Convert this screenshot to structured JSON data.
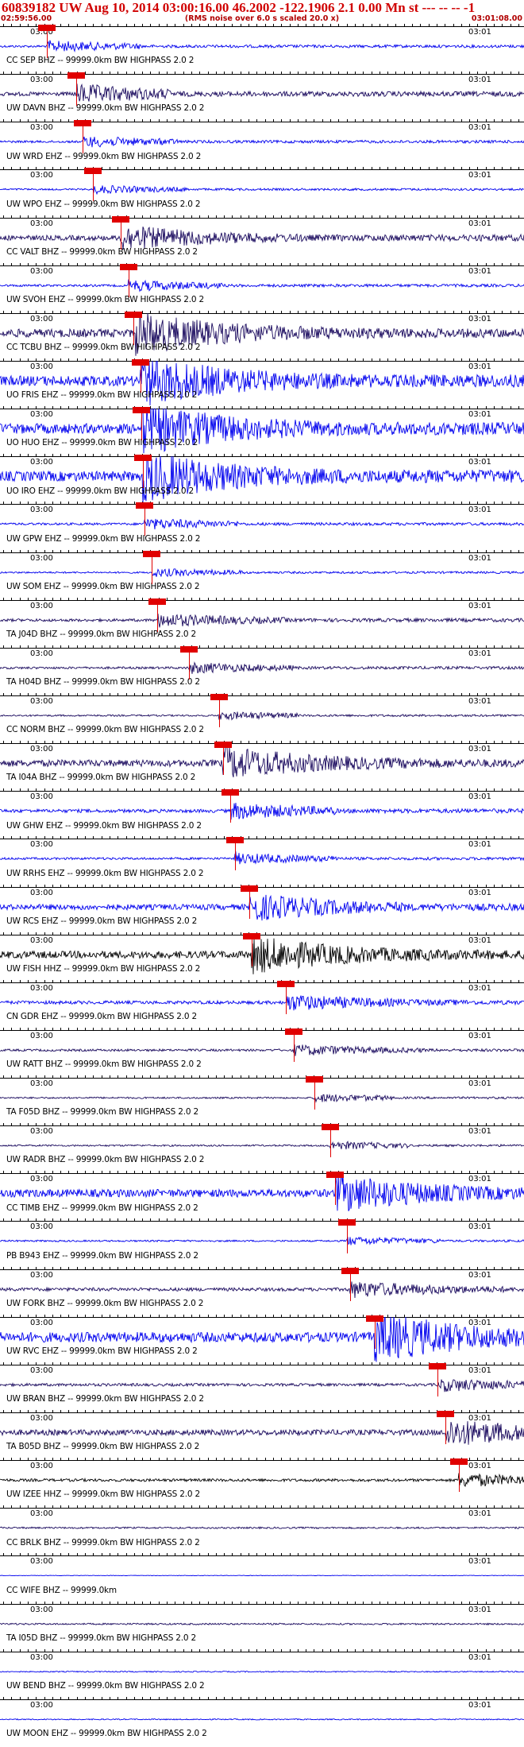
{
  "header": {
    "title": "60839182 UW Aug 10, 2014 03:00:16.00   46.2002 -122.1906  2.1 0.00 Mn st --- -- --   -1",
    "start_time": "02:59:56.00",
    "note": "(RMS noise over 6.0 s scaled 20.0 x)",
    "end_time": "03:01:08.00"
  },
  "time_labels": {
    "left": "03:00",
    "right": "03:01"
  },
  "colors": {
    "blue": "#0000ee",
    "dark": "#1a0a5e",
    "black": "#000000",
    "pick": "#e00000",
    "title": "#d00000"
  },
  "stations": [
    {
      "label": "CC SEP  BHZ -- 99999.0km BW  HIGHPASS  2.0  2",
      "color": "blue",
      "pick": 0.09,
      "burst": 0.18,
      "amp": 4
    },
    {
      "label": "UW DAVN BHZ -- 99999.0km BW  HIGHPASS  2.0  2",
      "color": "dark",
      "pick": 0.145,
      "burst": 0.18,
      "amp": 7
    },
    {
      "label": "UW WRD  EHZ -- 99999.0km BW  HIGHPASS  2.0  2",
      "color": "blue",
      "pick": 0.158,
      "burst": 0.18,
      "amp": 4
    },
    {
      "label": "UW WPO  EHZ -- 99999.0km BW  HIGHPASS  2.0  2",
      "color": "blue",
      "pick": 0.178,
      "burst": 0.18,
      "amp": 3
    },
    {
      "label": "CC VALT BHZ -- 99999.0km BW  HIGHPASS  2.0  2",
      "color": "dark",
      "pick": 0.23,
      "burst": 0.35,
      "amp": 9
    },
    {
      "label": "UW SVOH EHZ -- 99999.0km BW  HIGHPASS  2.0  2",
      "color": "blue",
      "pick": 0.245,
      "burst": 0.18,
      "amp": 4
    },
    {
      "label": "CC TCBU BHZ -- 99999.0km BW  HIGHPASS  2.0  2",
      "color": "dark",
      "pick": 0.255,
      "burst": 0.85,
      "amp": 15
    },
    {
      "label": "UO FRIS EHZ -- 99999.0km BW  HIGHPASS  2.0  2",
      "color": "blue",
      "pick": 0.268,
      "burst": 0.45,
      "amp": 18
    },
    {
      "label": "UO HUO  EHZ -- 99999.0km BW  HIGHPASS  2.0  2",
      "color": "blue",
      "pick": 0.27,
      "burst": 0.4,
      "amp": 18
    },
    {
      "label": "UO IRO  EHZ -- 99999.0km BW  HIGHPASS  2.0  2",
      "color": "blue",
      "pick": 0.272,
      "burst": 0.45,
      "amp": 18
    },
    {
      "label": "UW GPW  EHZ -- 99999.0km BW  HIGHPASS  2.0  2",
      "color": "blue",
      "pick": 0.275,
      "burst": 0.18,
      "amp": 4
    },
    {
      "label": "UW SOM  EHZ -- 99999.0km BW  HIGHPASS  2.0  2",
      "color": "blue",
      "pick": 0.29,
      "burst": 0.18,
      "amp": 3
    },
    {
      "label": "TA J04D BHZ -- 99999.0km BW  HIGHPASS  2.0  2",
      "color": "dark",
      "pick": 0.3,
      "burst": 0.25,
      "amp": 5
    },
    {
      "label": "TA H04D BHZ -- 99999.0km BW  HIGHPASS  2.0  2",
      "color": "dark",
      "pick": 0.36,
      "burst": 0.2,
      "amp": 4
    },
    {
      "label": "CC NORM BHZ -- 99999.0km BW  HIGHPASS  2.0  2",
      "color": "dark",
      "pick": 0.418,
      "burst": 0.15,
      "amp": 3
    },
    {
      "label": "TA I04A BHZ -- 99999.0km BW  HIGHPASS  2.0  2",
      "color": "dark",
      "pick": 0.425,
      "burst": 0.55,
      "amp": 12
    },
    {
      "label": "UW GHW  EHZ -- 99999.0km BW  HIGHPASS  2.0  2",
      "color": "blue",
      "pick": 0.44,
      "burst": 0.2,
      "amp": 6
    },
    {
      "label": "UW RRHS EHZ -- 99999.0km BW  HIGHPASS  2.0  2",
      "color": "blue",
      "pick": 0.448,
      "burst": 0.2,
      "amp": 4
    },
    {
      "label": "UW RCS  EHZ -- 99999.0km BW  HIGHPASS  2.0  2",
      "color": "blue",
      "pick": 0.475,
      "burst": 0.3,
      "amp": 10
    },
    {
      "label": "UW FISH HHZ -- 99999.0km BW  HIGHPASS  2.0  2",
      "color": "black",
      "pick": 0.48,
      "burst": 0.65,
      "amp": 13
    },
    {
      "label": "CN GDR  EHZ -- 99999.0km BW  HIGHPASS  2.0  2",
      "color": "blue",
      "pick": 0.545,
      "burst": 0.35,
      "amp": 6
    },
    {
      "label": "UW RATT BHZ -- 99999.0km BW  HIGHPASS  2.0  2",
      "color": "dark",
      "pick": 0.56,
      "burst": 0.25,
      "amp": 4
    },
    {
      "label": "TA F05D BHZ -- 99999.0km BW  HIGHPASS  2.0  2",
      "color": "dark",
      "pick": 0.6,
      "burst": 0.15,
      "amp": 3
    },
    {
      "label": "UW RADR BHZ -- 99999.0km BW  HIGHPASS  2.0  2",
      "color": "dark",
      "pick": 0.63,
      "burst": 0.15,
      "amp": 3
    },
    {
      "label": "CC TIMB EHZ -- 99999.0km BW  HIGHPASS  2.0  2",
      "color": "blue",
      "pick": 0.64,
      "burst": 0.6,
      "amp": 14
    },
    {
      "label": "PB B943 EHZ -- 99999.0km BW  HIGHPASS  2.0  2",
      "color": "blue",
      "pick": 0.662,
      "burst": 0.18,
      "amp": 3
    },
    {
      "label": "UW FORK BHZ -- 99999.0km BW  HIGHPASS  2.0  2",
      "color": "dark",
      "pick": 0.668,
      "burst": 0.3,
      "amp": 6
    },
    {
      "label": "UW RVC  EHZ -- 99999.0km BW  HIGHPASS  2.0  2",
      "color": "blue",
      "pick": 0.715,
      "burst": 0.7,
      "amp": 18
    },
    {
      "label": "UW BRAN BHZ -- 99999.0km BW  HIGHPASS  2.0  2",
      "color": "dark",
      "pick": 0.835,
      "burst": 0.25,
      "amp": 5
    },
    {
      "label": "TA B05D BHZ -- 99999.0km BW  HIGHPASS  2.0  2",
      "color": "dark",
      "pick": 0.85,
      "burst": 0.3,
      "amp": 10
    },
    {
      "label": "UW IZEE HHZ -- 99999.0km BW  HIGHPASS  2.0  2",
      "color": "black",
      "pick": 0.875,
      "burst": 0.2,
      "amp": 5
    },
    {
      "label": "CC BRLK BHZ -- 99999.0km BW  HIGHPASS  2.0  2",
      "color": "dark",
      "pick": null,
      "burst": 0.0,
      "amp": 3
    },
    {
      "label": "CC WIFE BHZ -- 99999.0km",
      "color": "blue",
      "pick": null,
      "burst": 0.0,
      "amp": 0
    },
    {
      "label": "TA I05D BHZ -- 99999.0km BW  HIGHPASS  2.0  2",
      "color": "dark",
      "pick": null,
      "burst": 0.0,
      "amp": 3
    },
    {
      "label": "UW BEND BHZ -- 99999.0km BW  HIGHPASS  2.0  2",
      "color": "blue",
      "pick": null,
      "burst": 0.0,
      "amp": 2
    },
    {
      "label": "UW MOON EHZ -- 99999.0km BW  HIGHPASS  2.0  2",
      "color": "blue",
      "pick": null,
      "burst": 0.0,
      "amp": 2
    }
  ]
}
